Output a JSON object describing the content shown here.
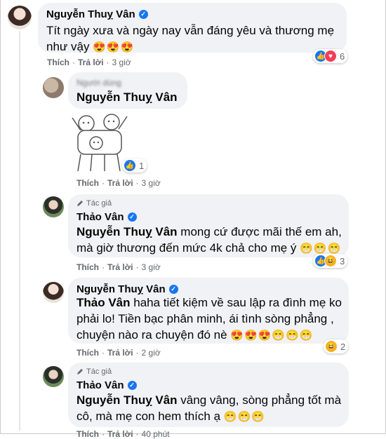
{
  "comments": [
    {
      "author": "Nguyễn Thuỵ Vân",
      "text": "Tít ngày xưa và ngày nay vẫn đáng yêu và thương mẹ như vậy",
      "emoji": "😍😍😍",
      "actions": {
        "like": "Thích",
        "reply": "Trả lời",
        "dot": "·",
        "time": "3 giờ"
      },
      "reactions": {
        "icons": [
          "like-icon",
          "love-icon"
        ],
        "count": "6"
      }
    },
    {
      "author_hidden": "Người dùng",
      "mention": "Nguyễn Thuỵ Vân",
      "sticker": "dancing-bears-sticker",
      "actions": {
        "like": "Thích",
        "reply": "Trả lời",
        "dot": "·",
        "time": "3 giờ"
      },
      "reactions": {
        "icons": [
          "like-icon"
        ],
        "count": "1"
      }
    },
    {
      "tag": "Tác giả",
      "author": "Thảo Vân",
      "mention": "Nguyễn Thuỵ Vân",
      "text": " mong cứ được mãi thế em ah, mà giờ thương đến mức 4k chả cho mẹ ý",
      "emoji": "😁😁😁",
      "actions": {
        "like": "Thích",
        "reply": "Trả lời",
        "dot": "·",
        "time": "3 giờ"
      },
      "reactions": {
        "icons": [
          "like-icon",
          "haha-icon"
        ],
        "count": "3"
      }
    },
    {
      "author": "Nguyễn Thuỵ Vân",
      "mention": "Thảo Vân",
      "text": " haha tiết kiệm về sau lập ra đình mẹ ko phải lo! Tiền bạc phân minh, ái tình sòng phẳng , chuyện nào ra chuyện đó nè",
      "emoji": "😍😍😍😁😁😁",
      "actions": {
        "like": "Thích",
        "reply": "Trả lời",
        "dot": "·",
        "time": "2 giờ"
      },
      "reactions": {
        "icons": [
          "haha-icon"
        ],
        "count": "2"
      }
    },
    {
      "tag": "Tác giả",
      "author": "Thảo Vân",
      "mention": "Nguyễn Thuỵ Vân",
      "text": " vâng vâng, sòng phẳng tốt mà cô, mà mẹ con hem thích ạ",
      "emoji": "😁😁😁",
      "actions": {
        "like": "Thích",
        "reply": "Trả lời",
        "dot": "·",
        "time": "40 phút"
      }
    }
  ],
  "colors": {
    "bubble": "#f0f2f5",
    "meta": "#65676b",
    "like": "#1877f2",
    "love": "#f33e58",
    "haha": "#f7b125"
  }
}
